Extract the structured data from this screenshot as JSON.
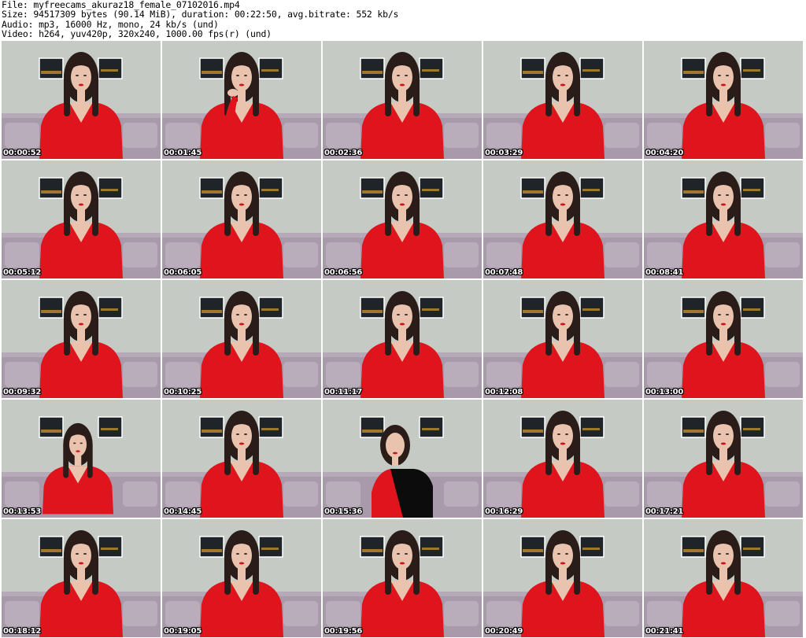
{
  "header": {
    "file_line": "File: myfreecams_akuraz18_female_07102016.mp4",
    "size_line": "Size: 94517309 bytes (90.14 MiB), duration: 00:22:50, avg.bitrate: 552 kb/s",
    "audio_line": "Audio: mp3, 16000 Hz, mono, 24 kb/s (und)",
    "video_line": "Video: h264, yuv420p, 320x240, 1000.00 fps(r) (und)"
  },
  "thumbnails": [
    {
      "time": "00:00:52",
      "variant": "normal"
    },
    {
      "time": "00:01:45",
      "variant": "hand"
    },
    {
      "time": "00:02:36",
      "variant": "normal"
    },
    {
      "time": "00:03:29",
      "variant": "normal"
    },
    {
      "time": "00:04:20",
      "variant": "normal"
    },
    {
      "time": "00:05:12",
      "variant": "normal"
    },
    {
      "time": "00:06:05",
      "variant": "normal"
    },
    {
      "time": "00:06:56",
      "variant": "normal"
    },
    {
      "time": "00:07:48",
      "variant": "normal"
    },
    {
      "time": "00:08:41",
      "variant": "normal"
    },
    {
      "time": "00:09:32",
      "variant": "normal"
    },
    {
      "time": "00:10:25",
      "variant": "normal"
    },
    {
      "time": "00:11:17",
      "variant": "normal"
    },
    {
      "time": "00:12:08",
      "variant": "normal"
    },
    {
      "time": "00:13:00",
      "variant": "normal"
    },
    {
      "time": "00:13:53",
      "variant": "far"
    },
    {
      "time": "00:14:45",
      "variant": "normal"
    },
    {
      "time": "00:15:36",
      "variant": "dark"
    },
    {
      "time": "00:16:29",
      "variant": "normal"
    },
    {
      "time": "00:17:21",
      "variant": "normal"
    },
    {
      "time": "00:18:12",
      "variant": "normal"
    },
    {
      "time": "00:19:05",
      "variant": "normal"
    },
    {
      "time": "00:19:56",
      "variant": "normal"
    },
    {
      "time": "00:20:49",
      "variant": "normal"
    },
    {
      "time": "00:21:41",
      "variant": "normal"
    }
  ],
  "colors": {
    "wall": "#c7cbc3",
    "couch": "#a89aab",
    "sweater": "#e0141c",
    "hair": "#2a1c18",
    "skin": "#e9c3ad",
    "timestamp_text": "#ffffff"
  }
}
